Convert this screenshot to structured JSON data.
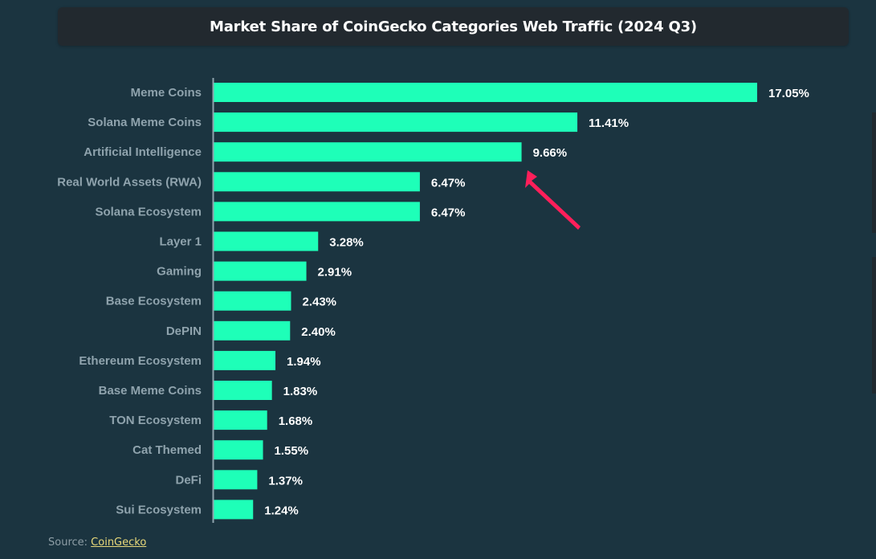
{
  "chart_data": {
    "type": "bar",
    "orientation": "horizontal",
    "title": "Market Share of CoinGecko Categories Web Traffic (2024 Q3)",
    "xlabel": "",
    "ylabel": "",
    "unit": "%",
    "grid": false,
    "legend": null,
    "categories": [
      "Meme Coins",
      "Solana Meme Coins",
      "Artificial Intelligence",
      "Real World Assets (RWA)",
      "Solana Ecosystem",
      "Layer 1",
      "Gaming",
      "Base Ecosystem",
      "DePIN",
      "Ethereum Ecosystem",
      "Base Meme Coins",
      "TON Ecosystem",
      "Cat Themed",
      "DeFi",
      "Sui Ecosystem"
    ],
    "values": [
      17.05,
      11.41,
      9.66,
      6.47,
      6.47,
      3.28,
      2.91,
      2.43,
      2.4,
      1.94,
      1.83,
      1.68,
      1.55,
      1.37,
      1.24
    ],
    "value_labels": [
      "17.05%",
      "11.41%",
      "9.66%",
      "6.47%",
      "6.47%",
      "3.28%",
      "2.91%",
      "2.43%",
      "2.40%",
      "1.94%",
      "1.83%",
      "1.68%",
      "1.55%",
      "1.37%",
      "1.24%"
    ],
    "xlim": [
      0,
      17.05
    ],
    "annotations": [
      {
        "type": "arrow",
        "target_category": "Artificial Intelligence",
        "color": "#ff1f5a"
      }
    ]
  },
  "colors": {
    "background": "#1b3440",
    "title_box": "#22292f",
    "bar": "#1effb8",
    "category_text": "#8fa3ad",
    "value_text": "#ffffff",
    "axis": "#8fa3ad",
    "arrow": "#ff1f5a",
    "source_link": "#e8d87a"
  },
  "source": {
    "prefix": "Source: ",
    "link_text": "CoinGecko"
  }
}
